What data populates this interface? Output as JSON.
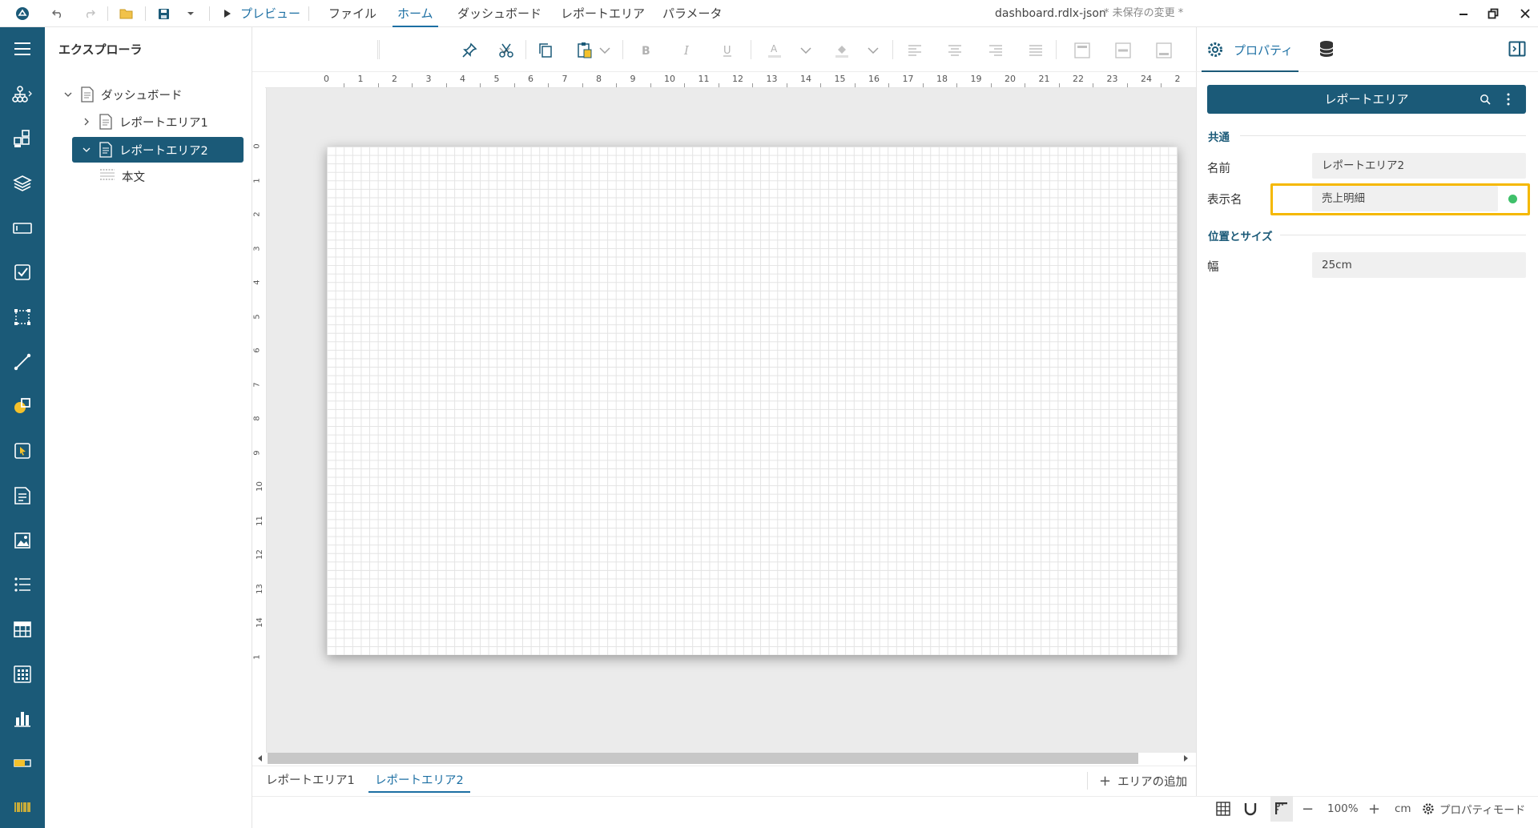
{
  "titlebar": {
    "menus": [
      "ファイル",
      "ホーム",
      "ダッシュボード",
      "レポートエリア",
      "パラメータ"
    ],
    "preview_label": "プレビュー",
    "document": "dashboard.rdlx-json",
    "unsaved": "* 未保存の変更 *"
  },
  "explorer": {
    "title": "エクスプローラ",
    "tree": {
      "root": "ダッシュボード",
      "area1": "レポートエリア1",
      "area2": "レポートエリア2",
      "body": "本文"
    }
  },
  "rulers": {
    "top": [
      "0",
      "1",
      "2",
      "3",
      "4",
      "5",
      "6",
      "7",
      "8",
      "9",
      "10",
      "11",
      "12",
      "13",
      "14",
      "15",
      "16",
      "17",
      "18",
      "19",
      "20",
      "21",
      "22",
      "23",
      "24",
      "2"
    ],
    "left": [
      "0",
      "1",
      "2",
      "3",
      "4",
      "5",
      "6",
      "7",
      "8",
      "9",
      "10",
      "11",
      "12",
      "13",
      "14",
      "1"
    ]
  },
  "tabs": {
    "area1": "レポートエリア1",
    "area2": "レポートエリア2",
    "add_area": "エリアの追加"
  },
  "status": {
    "zoom": "100%",
    "unit": "cm",
    "property_mode": "プロパティモード"
  },
  "panel": {
    "properties_tab": "プロパティ",
    "header": "レポートエリア",
    "section_common": "共通",
    "name_label": "名前",
    "name_value": "レポートエリア2",
    "display_name_label": "表示名",
    "display_name_value": "売上明細",
    "section_position": "位置とサイズ",
    "width_label": "幅",
    "width_value": "25cm"
  },
  "colors": {
    "rail": "#1b5a78",
    "accent": "#1c6fa3",
    "highlight": "#f5b800",
    "status_dot": "#3fc06a"
  },
  "icons": {
    "rail": [
      "menu-icon",
      "tree-icon",
      "components-icon",
      "layers-icon",
      "textbox-icon",
      "checkbox-icon",
      "container-icon",
      "line-icon",
      "shapes-icon",
      "pointer-icon",
      "richtext-icon",
      "image-icon",
      "list-icon",
      "table-icon",
      "tablix-icon",
      "chart-icon",
      "bullet-icon",
      "barcode-icon"
    ]
  }
}
